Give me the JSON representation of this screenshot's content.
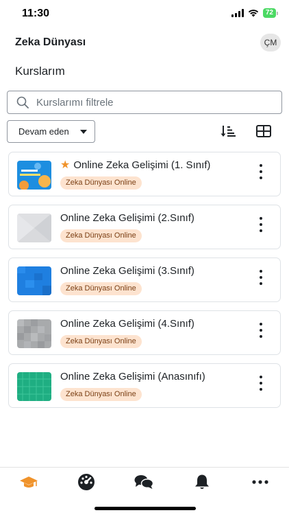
{
  "status_bar": {
    "time": "11:30",
    "battery": "72"
  },
  "header": {
    "app_title": "Zeka Dünyası",
    "avatar_initials": "ÇM"
  },
  "page": {
    "title": "Kurslarım"
  },
  "search": {
    "placeholder": "Kurslarımı filtrele",
    "value": ""
  },
  "filter": {
    "selected": "Devam eden"
  },
  "toolbar": {
    "sort_icon": "sort-descending-icon",
    "view_icon": "grid-view-icon"
  },
  "courses": [
    {
      "name": "Online Zeka Gelişimi (1. Sınıf)",
      "category": "Zeka Dünyası Online",
      "starred": true,
      "thumb_color": "#1d8ee0",
      "thumb_text": "1. SINIF ZEKA ATÖLYESİ"
    },
    {
      "name": "Online Zeka Gelişimi (2.Sınıf)",
      "category": "Zeka Dünyası Online",
      "starred": false,
      "thumb_color": "#d9dadd"
    },
    {
      "name": "Online Zeka Gelişimi (3.Sınıf)",
      "category": "Zeka Dünyası Online",
      "starred": false,
      "thumb_color": "#1f7fe0"
    },
    {
      "name": "Online Zeka Gelişimi (4.Sınıf)",
      "category": "Zeka Dünyası Online",
      "starred": false,
      "thumb_color": "#a8aaac"
    },
    {
      "name": "Online Zeka Gelişimi (Anasınıfı)",
      "category": "Zeka Dünyası Online",
      "starred": false,
      "thumb_color": "#1fae82"
    }
  ],
  "tabs": [
    {
      "icon": "graduation-cap-icon",
      "active": true
    },
    {
      "icon": "dashboard-gauge-icon",
      "active": false
    },
    {
      "icon": "messages-icon",
      "active": false
    },
    {
      "icon": "notifications-bell-icon",
      "active": false
    },
    {
      "icon": "more-icon",
      "active": false
    }
  ],
  "colors": {
    "accent": "#f0932b",
    "badge_bg": "#fde3cf",
    "badge_text": "#7a3f14",
    "text": "#1d2125"
  }
}
